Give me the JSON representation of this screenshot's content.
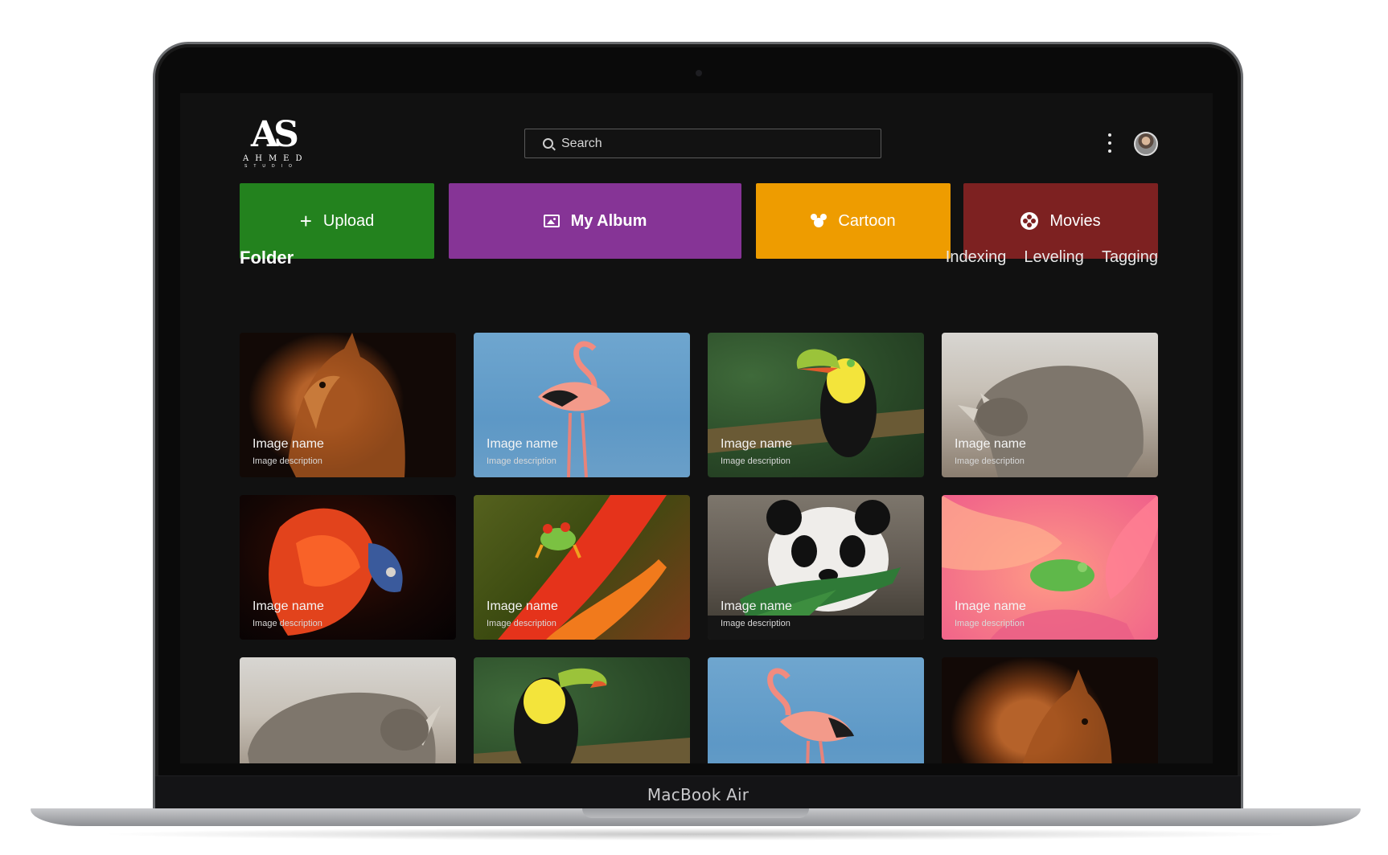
{
  "device": {
    "label": "MacBook Air"
  },
  "logo": {
    "mark": "AS",
    "word": "AHMED",
    "sub": "STUDIO"
  },
  "search": {
    "placeholder": "Search"
  },
  "actions": [
    {
      "label": "Upload",
      "icon": "plus-icon",
      "color": "#23821e"
    },
    {
      "label": "My Album",
      "icon": "image-icon",
      "color": "#863496"
    },
    {
      "label": "Cartoon",
      "icon": "mouse-ears-icon",
      "color": "#ee9c00"
    },
    {
      "label": "Movies",
      "icon": "film-reel-icon",
      "color": "#7d2121"
    }
  ],
  "section": {
    "title": "Folder"
  },
  "tabs": [
    "Indexing",
    "Leveling",
    "Tagging"
  ],
  "cards": [
    {
      "subject": "cat",
      "name": "Image name",
      "description": "Image description"
    },
    {
      "subject": "flamingo",
      "name": "Image name",
      "description": "Image description"
    },
    {
      "subject": "toucan",
      "name": "Image name",
      "description": "Image description"
    },
    {
      "subject": "rhino",
      "name": "Image name",
      "description": "Image description"
    },
    {
      "subject": "betta-fish",
      "name": "Image name",
      "description": "Image description"
    },
    {
      "subject": "tree-frog",
      "name": "Image name",
      "description": "Image description"
    },
    {
      "subject": "panda",
      "name": "Image name",
      "description": "Image description"
    },
    {
      "subject": "frog-on-rose",
      "name": "Image name",
      "description": "Image description"
    },
    {
      "subject": "rhino"
    },
    {
      "subject": "toucan"
    },
    {
      "subject": "flamingo"
    },
    {
      "subject": "cat"
    }
  ]
}
